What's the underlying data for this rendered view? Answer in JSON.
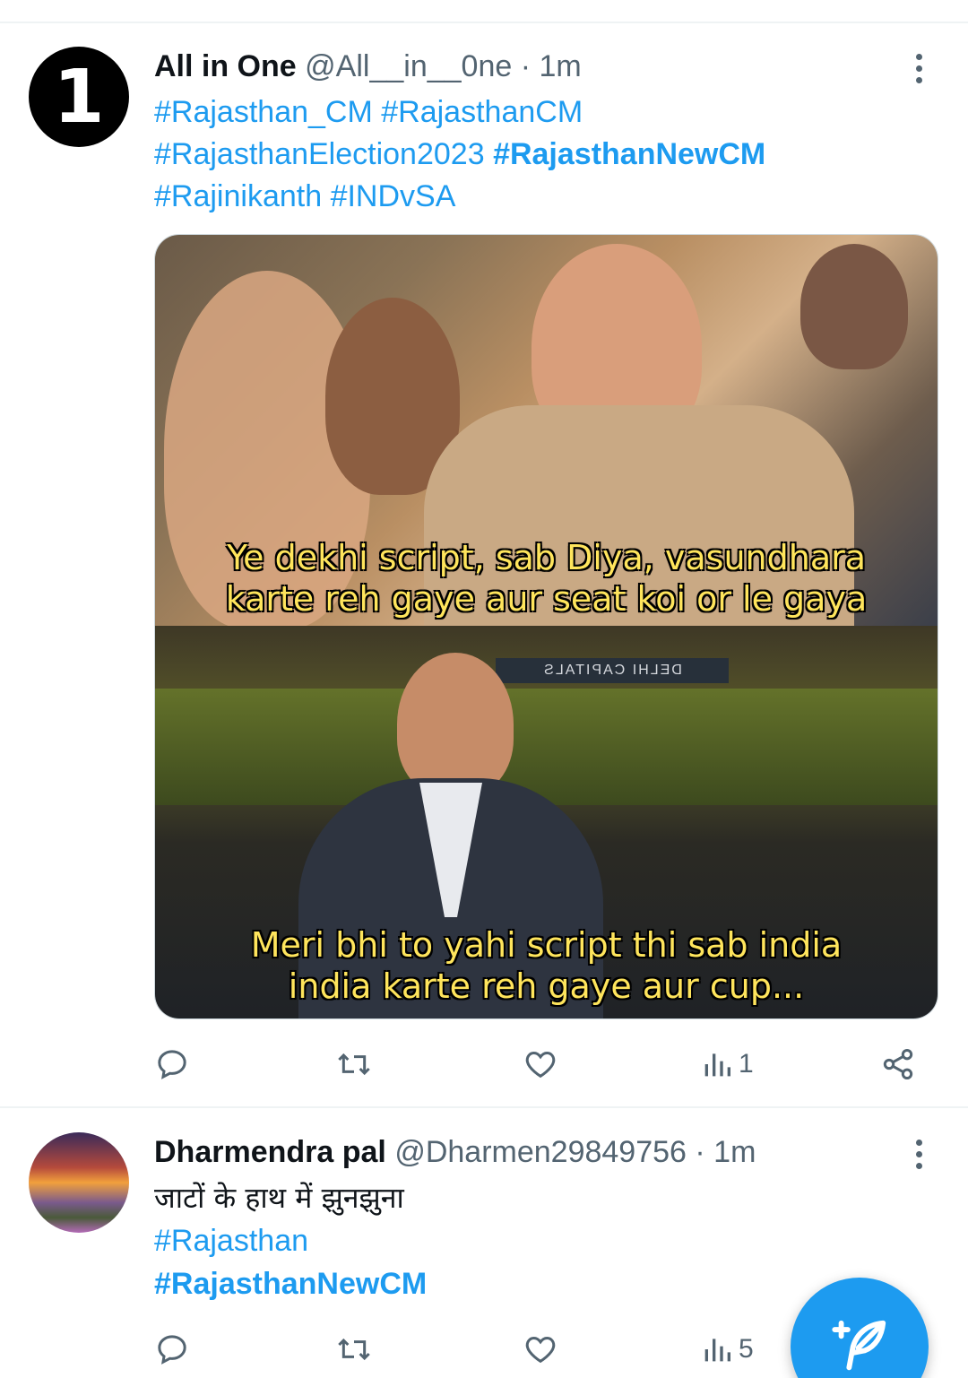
{
  "tweets": [
    {
      "name": "All in One",
      "handle": "@All__in__0ne",
      "sep": "·",
      "time": "1m",
      "avatar_digit": "1",
      "lines": [
        [
          "#Rajasthan_CM",
          "#RajasthanCM"
        ],
        [
          "#RajasthanElection2023",
          "#RajasthanNewCM"
        ],
        [
          "#Rajinikanth",
          "#INDvSA"
        ]
      ],
      "media": {
        "caption_top_1": "Ye dekhi script, sab Diya, vasundhara",
        "caption_top_2": "karte reh gaye aur seat koi or le gaya",
        "caption_bottom_1": "Meri bhi to yahi script thi sab india",
        "caption_bottom_2": "india karte reh gaye aur cup...",
        "sign_text": "DELHI CAPITALS"
      },
      "views": "1"
    },
    {
      "name": "Dharmendra pal",
      "handle": "@Dharmen29849756",
      "sep": "·",
      "time": "1m",
      "text": "जाटों के हाथ में झुनझुना",
      "tag1": "#Rajasthan",
      "tag2": "#RajasthanNewCM",
      "views": "5"
    }
  ],
  "icons": {
    "reply": "reply-icon",
    "retweet": "retweet-icon",
    "like": "heart-icon",
    "views": "views-icon",
    "share": "share-icon",
    "compose": "compose-feather-icon"
  },
  "colors": {
    "accent": "#1d9bf0",
    "text": "#0f1419",
    "muted": "#536471"
  }
}
